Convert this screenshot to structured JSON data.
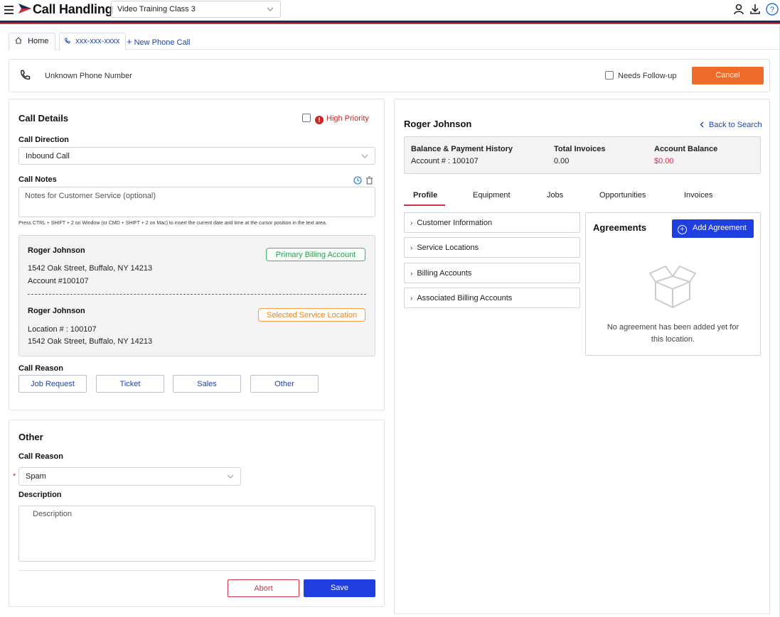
{
  "header": {
    "title": "Call Handling",
    "class_select": "Video Training Class 3",
    "icons": [
      "user-icon",
      "download-icon",
      "help-icon"
    ]
  },
  "tabs": {
    "home": "Home",
    "phone": "xxx-xxx-xxxx",
    "new_call": "New Phone Call"
  },
  "call_header": {
    "phone_label": "Unknown Phone Number",
    "needs_followup": "Needs Follow-up",
    "cancel": "Cancel"
  },
  "call_details": {
    "title": "Call Details",
    "high_priority": "High Priority",
    "direction_label": "Call Direction",
    "direction_value": "Inbound Call",
    "notes_label": "Call Notes",
    "notes_placeholder": "Notes for Customer Service (optional)",
    "hint": "Press CTRL + SHIFT + 2 on Window (or CMD + SHIFT + 2 on Mac) to insert the current date and time at the cursor position in the text area.",
    "billing": {
      "name": "Roger Johnson",
      "address": "1542 Oak Street, Buffalo, NY 14213",
      "account": "Account #100107",
      "badge": "Primary Billing Account"
    },
    "service": {
      "name": "Roger Johnson",
      "location": "Location # : 100107",
      "address": "1542 Oak Street, Buffalo, NY 14213",
      "badge": "Selected Service Location"
    },
    "reason_label": "Call Reason",
    "reasons": [
      "Job Request",
      "Ticket",
      "Sales",
      "Other"
    ]
  },
  "other": {
    "title": "Other",
    "reason_label": "Call Reason",
    "reason_value": "Spam",
    "required_mark": "*",
    "description_label": "Description",
    "description_placeholder": "Description",
    "abort": "Abort",
    "save": "Save"
  },
  "customer": {
    "name": "Roger Johnson",
    "back": "Back to Search",
    "balance_history": "Balance & Payment History",
    "account_line": "Account # : 100107",
    "total_invoices_label": "Total Invoices",
    "total_invoices_value": "0.00",
    "account_balance_label": "Account Balance",
    "account_balance_value": "$0.00",
    "profile_tabs": [
      "Profile",
      "Equipment",
      "Jobs",
      "Opportunities",
      "Invoices"
    ],
    "sections": [
      "Customer Information",
      "Service Locations",
      "Billing Accounts",
      "Associated Billing Accounts"
    ],
    "agreements_title": "Agreements",
    "add_agreement": "Add Agreement",
    "empty_text": "No agreement has been added yet for this location."
  },
  "colors": {
    "accent_blue": "#1f3fe0",
    "cancel_orange": "#f06a2a",
    "priority_red": "#c62828",
    "primary_green": "#2f9a55",
    "service_orange": "#e8892c"
  }
}
